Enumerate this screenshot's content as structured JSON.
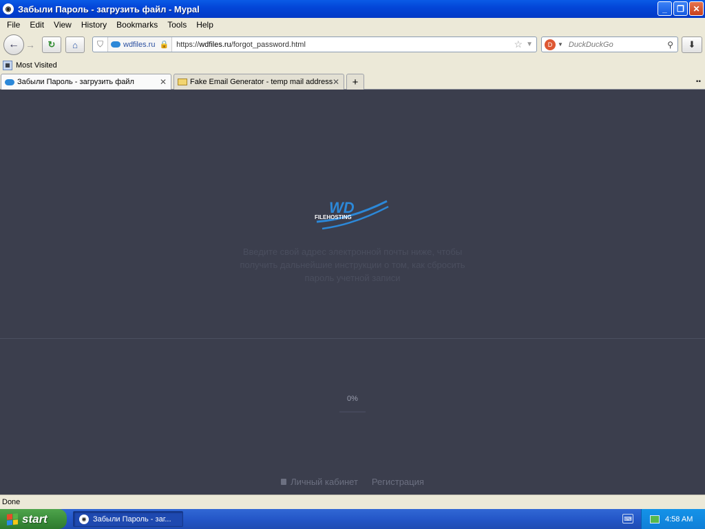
{
  "window": {
    "title": "Забыли Пароль - загрузить файл - Mypal"
  },
  "menu": {
    "items": [
      "File",
      "Edit",
      "View",
      "History",
      "Bookmarks",
      "Tools",
      "Help"
    ]
  },
  "nav": {
    "identity": "wdfiles.ru",
    "url_prefix": "https://",
    "url_host": "wdfiles.ru",
    "url_path": "/forgot_password.html",
    "search_placeholder": "DuckDuckGo"
  },
  "bookmarks": {
    "most_visited": "Most Visited"
  },
  "tabs": [
    {
      "label": "Забыли Пароль - загрузить файл",
      "active": true,
      "icon": "wdfiles-cloud-icon"
    },
    {
      "label": "Fake Email Generator - temp mail address",
      "active": false,
      "icon": "mail-icon"
    }
  ],
  "page": {
    "logo_text": "WD",
    "logo_sub": "FILEHOSTING",
    "description": "Введите свой адрес электронной почты ниже, чтобы получить дальнейшие инструкции о том, как сбросить пароль учетной записи",
    "progress_label": "0%",
    "progress": 0,
    "footer": {
      "cabinet": "Личный кабинет",
      "register": "Регистрация"
    }
  },
  "status": {
    "text": "Done"
  },
  "taskbar": {
    "start": "start",
    "task_label": "Забыли Пароль - заг...",
    "clock": "4:58 AM"
  },
  "colors": {
    "page_bg": "#3b3e4d",
    "accent": "#2c88d8",
    "taskbar": "#2457c8"
  }
}
